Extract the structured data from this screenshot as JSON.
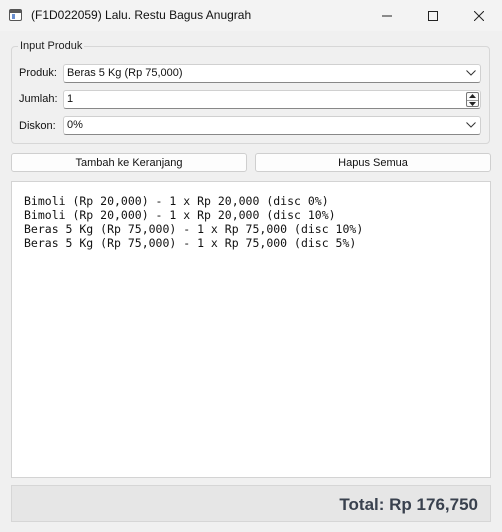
{
  "window": {
    "title": "(F1D022059) Lalu. Restu Bagus Anugrah"
  },
  "form": {
    "group_title": "Input Produk",
    "produk": {
      "label": "Produk:",
      "value": "Beras 5 Kg (Rp 75,000)"
    },
    "jumlah": {
      "label": "Jumlah:",
      "value": "1"
    },
    "diskon": {
      "label": "Diskon:",
      "value": "0%"
    }
  },
  "buttons": {
    "add_label": "Tambah ke Keranjang",
    "clear_label": "Hapus Semua"
  },
  "cart": {
    "items": [
      "Bimoli (Rp 20,000) - 1 x Rp 20,000 (disc 0%)",
      "Bimoli (Rp 20,000) - 1 x Rp 20,000 (disc 10%)",
      "Beras 5 Kg (Rp 75,000) - 1 x Rp 75,000 (disc 10%)",
      "Beras 5 Kg (Rp 75,000) - 1 x Rp 75,000 (disc 5%)"
    ]
  },
  "total": {
    "label": "Total: Rp 176,750"
  },
  "icons": {
    "app": "app-window-icon",
    "minimize": "minimize-icon",
    "maximize": "maximize-icon",
    "close": "close-icon",
    "dropdown": "chevron-down-icon",
    "spin_up": "spin-up-arrow-icon",
    "spin_down": "spin-down-arrow-icon"
  }
}
